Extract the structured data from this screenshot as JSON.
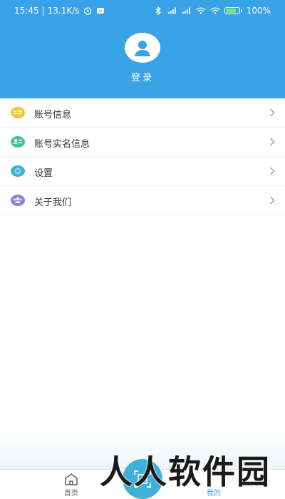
{
  "status_bar": {
    "time": "15:45",
    "net_speed": "13.1K/s",
    "battery": "100%",
    "icons": [
      "alarm-icon",
      "app-notification-icon",
      "bluetooth-icon",
      "signal-icon",
      "signal-icon",
      "wifi-icon",
      "wifi-icon",
      "battery-icon"
    ]
  },
  "header": {
    "login_label": "登录",
    "background_color": "#3aa2e6",
    "avatar_icon": "user-icon"
  },
  "menu": {
    "items": [
      {
        "label": "账号信息",
        "icon": "account-card-icon",
        "color": "#f0c53a"
      },
      {
        "label": "账号实名信息",
        "icon": "id-card-icon",
        "color": "#46c48e"
      },
      {
        "label": "设置",
        "icon": "settings-gear-icon",
        "color": "#3fb0d8"
      },
      {
        "label": "关于我们",
        "icon": "group-users-icon",
        "color": "#8d7fd6"
      }
    ]
  },
  "tab_bar": {
    "home_label": "首页",
    "mine_label": "我的",
    "center_icon": "scan-icon",
    "active_color": "#3aa2e6"
  },
  "watermark": "人人软件园"
}
